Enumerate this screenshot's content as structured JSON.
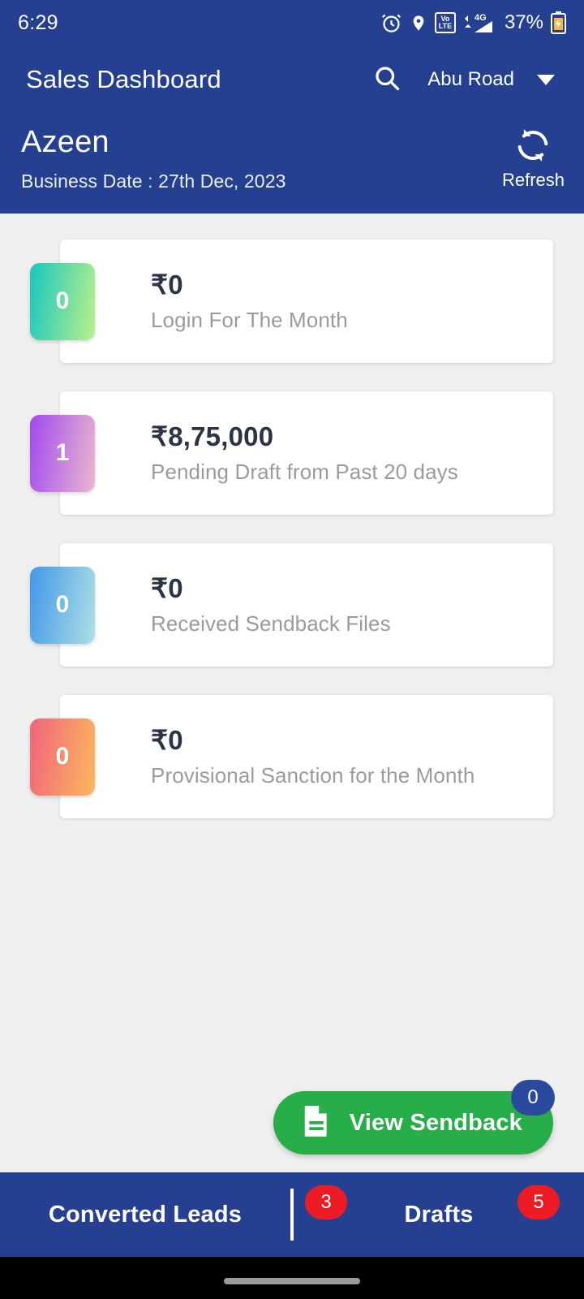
{
  "statusbar": {
    "time": "6:29",
    "battery_percent": "37%",
    "network": "4G",
    "volte_top": "Vo",
    "volte_bottom": "LTE",
    "icons": [
      "alarm-icon",
      "location-icon",
      "volte-icon",
      "signal-icon",
      "battery-icon"
    ]
  },
  "appbar": {
    "title": "Sales Dashboard",
    "search_icon": "search-icon",
    "branch": "Abu Road",
    "dropdown_icon": "chevron-down-icon",
    "user_name": "Azeen",
    "business_date": "Business Date : 27th Dec, 2023",
    "refresh_label": "Refresh",
    "refresh_icon": "refresh-icon",
    "background_color": "#254090"
  },
  "cards": [
    {
      "count": "0",
      "amount": "₹0",
      "label": "Login For The Month",
      "gradient_from": "#16c7c0",
      "gradient_to": "#bcf08a"
    },
    {
      "count": "1",
      "amount": "₹8,75,000",
      "label": "Pending Draft from Past 20 days",
      "gradient_from": "#a149f0",
      "gradient_to": "#eab8cd"
    },
    {
      "count": "0",
      "amount": "₹0",
      "label": "Received Sendback Files",
      "gradient_from": "#4197e8",
      "gradient_to": "#aee0e6"
    },
    {
      "count": "0",
      "amount": "₹0",
      "label": "Provisional Sanction for the Month",
      "gradient_from": "#f2637d",
      "gradient_to": "#fbb85e"
    }
  ],
  "fab": {
    "label": "View Sendback",
    "badge": "0",
    "icon": "document-icon",
    "color": "#27ae48",
    "badge_color": "#2a4a9e"
  },
  "bottom_nav": {
    "items": [
      {
        "label": "Converted Leads",
        "badge": "3"
      },
      {
        "label": "Drafts",
        "badge": "5"
      }
    ],
    "badge_color": "#ed1b24",
    "background_color": "#254090"
  }
}
